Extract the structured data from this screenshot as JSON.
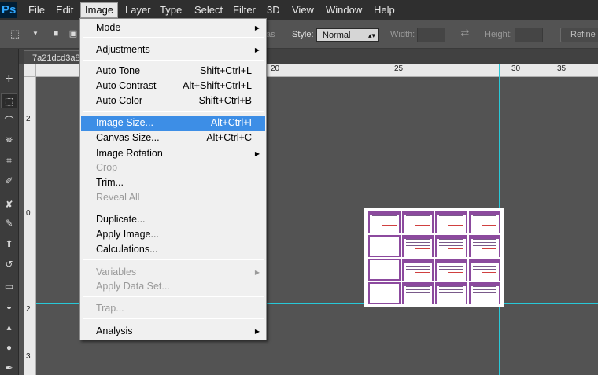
{
  "app": {
    "logo": "Ps"
  },
  "menubar": {
    "items": [
      "File",
      "Edit",
      "Image",
      "Layer",
      "Type",
      "Select",
      "Filter",
      "3D",
      "View",
      "Window",
      "Help"
    ]
  },
  "options_bar": {
    "partial_label": "as",
    "style_label": "Style:",
    "style_value": "Normal",
    "width_label": "Width:",
    "height_label": "Height:",
    "refine_edge": "Refine E"
  },
  "document": {
    "tab_label": "7a21dcd3a8"
  },
  "rulers": {
    "top": [
      "20",
      "25",
      "30",
      "35"
    ],
    "left": [
      "2",
      "0",
      "2",
      "3"
    ]
  },
  "image_menu": {
    "items": [
      {
        "label": "Mode",
        "shortcut": "",
        "submenu": true,
        "disabled": false
      },
      {
        "label": "Adjustments",
        "shortcut": "",
        "submenu": true,
        "disabled": false
      },
      {
        "label": "Auto Tone",
        "shortcut": "Shift+Ctrl+L",
        "submenu": false,
        "disabled": false
      },
      {
        "label": "Auto Contrast",
        "shortcut": "Alt+Shift+Ctrl+L",
        "submenu": false,
        "disabled": false
      },
      {
        "label": "Auto Color",
        "shortcut": "Shift+Ctrl+B",
        "submenu": false,
        "disabled": false
      },
      {
        "label": "Image Size...",
        "shortcut": "Alt+Ctrl+I",
        "submenu": false,
        "disabled": false,
        "highlighted": true
      },
      {
        "label": "Canvas Size...",
        "shortcut": "Alt+Ctrl+C",
        "submenu": false,
        "disabled": false
      },
      {
        "label": "Image Rotation",
        "shortcut": "",
        "submenu": true,
        "disabled": false
      },
      {
        "label": "Crop",
        "shortcut": "",
        "submenu": false,
        "disabled": true
      },
      {
        "label": "Trim...",
        "shortcut": "",
        "submenu": false,
        "disabled": false
      },
      {
        "label": "Reveal All",
        "shortcut": "",
        "submenu": false,
        "disabled": true
      },
      {
        "label": "Duplicate...",
        "shortcut": "",
        "submenu": false,
        "disabled": false
      },
      {
        "label": "Apply Image...",
        "shortcut": "",
        "submenu": false,
        "disabled": false
      },
      {
        "label": "Calculations...",
        "shortcut": "",
        "submenu": false,
        "disabled": false
      },
      {
        "label": "Variables",
        "shortcut": "",
        "submenu": true,
        "disabled": true
      },
      {
        "label": "Apply Data Set...",
        "shortcut": "",
        "submenu": false,
        "disabled": true
      },
      {
        "label": "Trap...",
        "shortcut": "",
        "submenu": false,
        "disabled": true
      },
      {
        "label": "Analysis",
        "shortcut": "",
        "submenu": true,
        "disabled": false
      }
    ]
  },
  "tools": {
    "icons": [
      "move-tool-icon",
      "marquee-tool-icon",
      "lasso-tool-icon",
      "magic-wand-tool-icon",
      "crop-tool-icon",
      "eyedropper-tool-icon",
      "healing-brush-tool-icon",
      "brush-tool-icon",
      "clone-stamp-tool-icon",
      "history-brush-tool-icon",
      "eraser-tool-icon",
      "paint-bucket-tool-icon",
      "blur-tool-icon",
      "dodge-tool-icon",
      "pen-tool-icon"
    ]
  },
  "colors": {
    "highlight": "#3d8ee6",
    "guide": "#28c8d8",
    "card_border": "#8c4a9e"
  }
}
